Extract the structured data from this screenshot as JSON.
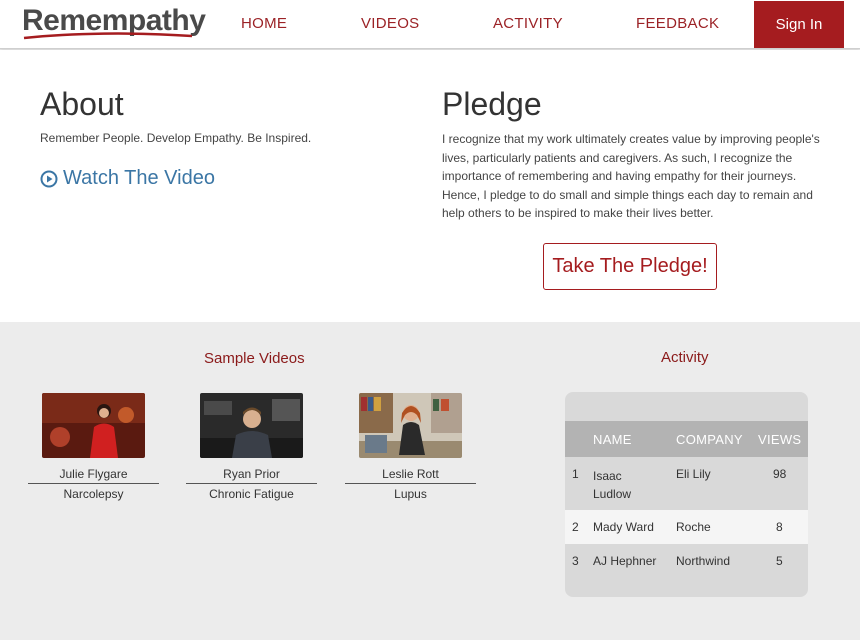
{
  "brand": {
    "name": "Remempathy",
    "accent": "#a51c1f",
    "link_color": "#3b76a5"
  },
  "nav": {
    "items": [
      "HOME",
      "VIDEOS",
      "ACTIVITY",
      "FEEDBACK"
    ],
    "signin_label": "Sign In"
  },
  "about": {
    "title": "About",
    "tagline": "Remember People. Develop Empathy. Be Inspired.",
    "watch_label": "Watch The Video",
    "watch_icon": "play-circle-icon"
  },
  "pledge": {
    "title": "Pledge",
    "text": "I recognize that my work ultimately creates value by improving people's lives, particularly patients and caregivers. As such, I recognize the importance of remembering and having empathy for their journeys. Hence, I pledge to do small and simple things each day to remain and help others to be inspired to make their lives better.",
    "button_label": "Take The Pledge!"
  },
  "videos": {
    "title": "Sample Videos",
    "items": [
      {
        "name": "Julie Flygare",
        "condition": "Narcolepsy"
      },
      {
        "name": "Ryan Prior",
        "condition": "Chronic Fatigue"
      },
      {
        "name": "Leslie Rott",
        "condition": "Lupus"
      }
    ]
  },
  "activity": {
    "title": "Activity",
    "columns": [
      "NAME",
      "COMPANY",
      "VIEWS"
    ],
    "rows": [
      {
        "rank": "1",
        "name": "Isaac Ludlow",
        "name_line1": "Isaac",
        "name_line2": "Ludlow",
        "company": "Eli Lily",
        "views": "98"
      },
      {
        "rank": "2",
        "name": "Mady Ward",
        "company": "Roche",
        "views": "8"
      },
      {
        "rank": "3",
        "name": "AJ Hephner",
        "company": "Northwind",
        "views": "5"
      }
    ]
  }
}
